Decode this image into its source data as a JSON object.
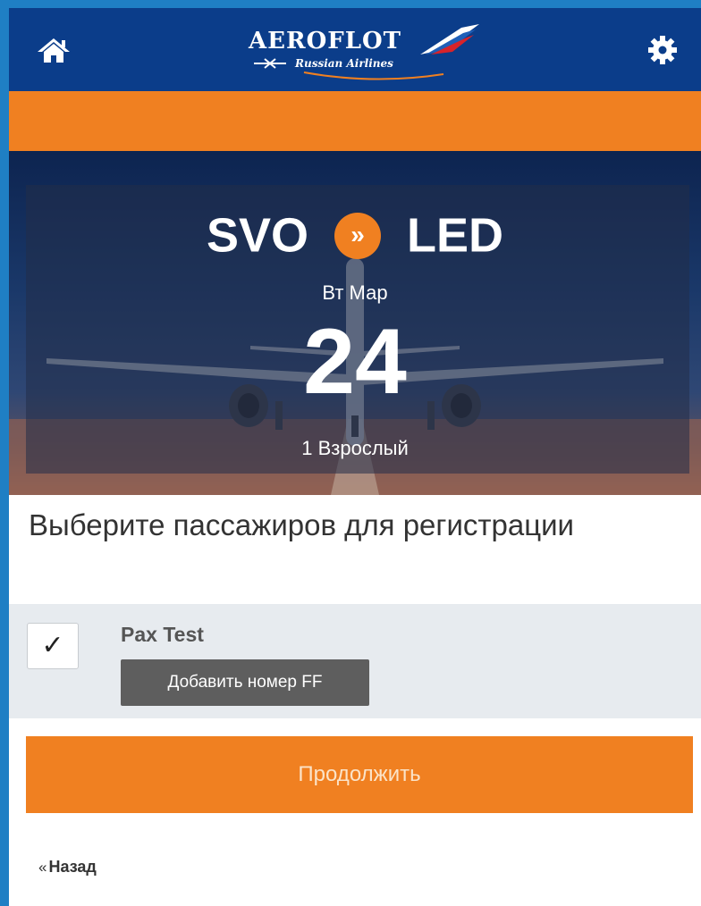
{
  "header": {
    "logo_text": "AEROFLOT",
    "logo_subtitle": "Russian Airlines",
    "brand_color": "#0b3d8a",
    "home_icon": "home-icon",
    "settings_icon": "gear-icon"
  },
  "flight": {
    "origin": "SVO",
    "destination": "LED",
    "route_arrow": "»",
    "weekday_month": "Вт Мар",
    "day": "24",
    "passengers": "1 Взрослый"
  },
  "selection": {
    "title": "Выберите пассажиров для регистрации",
    "passengers": [
      {
        "name": "Pax Test",
        "checked": true,
        "check_mark": "✓",
        "add_ff_label": "Добавить номер FF"
      }
    ]
  },
  "actions": {
    "continue_label": "Продолжить",
    "back_quote": "«",
    "back_label": "Назад"
  },
  "colors": {
    "accent": "#f08021",
    "button_gray": "#5e5e5e"
  }
}
